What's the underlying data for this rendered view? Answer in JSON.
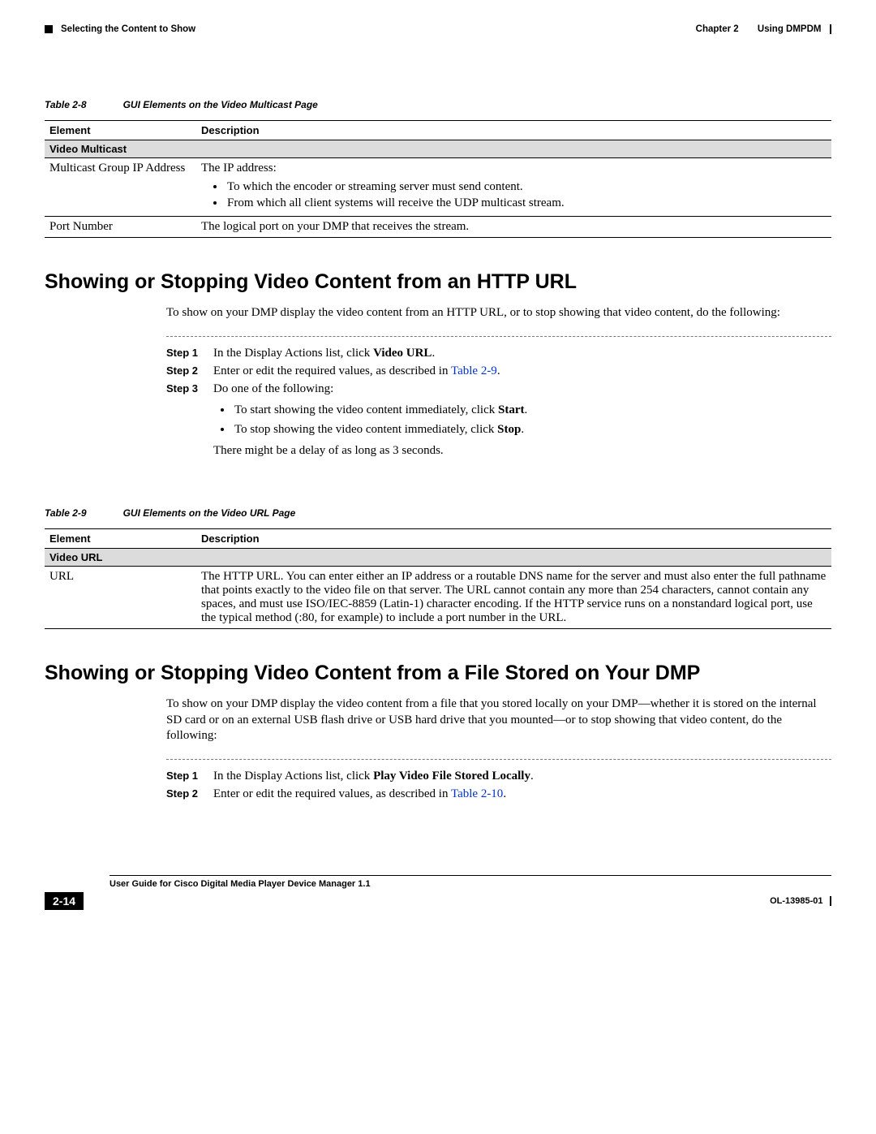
{
  "header": {
    "chapter": "Chapter 2",
    "chapter_title": "Using DMPDM",
    "breadcrumb": "Selecting the Content to Show"
  },
  "table8": {
    "caption_label": "Table 2-8",
    "caption_title": "GUI Elements on the Video Multicast Page",
    "col1": "Element",
    "col2": "Description",
    "section": "Video Multicast",
    "row1_el": "Multicast Group IP Address",
    "row1_desc_intro": "The IP address:",
    "row1_b1": "To which the encoder or streaming server must send content.",
    "row1_b2": "From which all client systems will receive the UDP multicast stream.",
    "row2_el": "Port Number",
    "row2_desc": "The logical port on your DMP that receives the stream."
  },
  "section1": {
    "heading": "Showing or Stopping Video Content from an HTTP URL",
    "intro": "To show on your DMP display the video content from an HTTP URL, or to stop showing that video content, do the following:",
    "step1_label": "Step 1",
    "step1_text_a": "In the Display Actions list, click ",
    "step1_bold": "Video URL",
    "step1_text_b": ".",
    "step2_label": "Step 2",
    "step2_text_a": "Enter or edit the required values, as described in ",
    "step2_link": "Table 2-9",
    "step2_text_b": ".",
    "step3_label": "Step 3",
    "step3_text": "Do one of the following:",
    "step3_b1a": "To start showing the video content immediately, click ",
    "step3_b1b": "Start",
    "step3_b1c": ".",
    "step3_b2a": "To stop showing the video content immediately, click ",
    "step3_b2b": "Stop",
    "step3_b2c": ".",
    "step3_note": "There might be a delay of as long as 3 seconds."
  },
  "table9": {
    "caption_label": "Table 2-9",
    "caption_title": "GUI Elements on the Video URL Page",
    "col1": "Element",
    "col2": "Description",
    "section": "Video URL",
    "row1_el": "URL",
    "row1_desc": "The HTTP URL. You can enter either an IP address or a routable DNS name for the server and must also enter the full pathname that points exactly to the video file on that server. The URL cannot contain any more than 254 characters, cannot contain any spaces, and must use ISO/IEC-8859 (Latin-1) character encoding. If the HTTP service runs on a nonstandard logical port, use the typical method (:80, for example) to include a port number in the URL."
  },
  "section2": {
    "heading": "Showing or Stopping Video Content from a File Stored on Your DMP",
    "intro": "To show on your DMP display the video content from a file that you stored locally on your DMP—whether it is stored on the internal SD card or on an external USB flash drive or USB hard drive that you mounted—or to stop showing that video content, do the following:",
    "step1_label": "Step 1",
    "step1_text_a": "In the Display Actions list, click ",
    "step1_bold": "Play Video File Stored Locally",
    "step1_text_b": ".",
    "step2_label": "Step 2",
    "step2_text_a": "Enter or edit the required values, as described in ",
    "step2_link": "Table 2-10",
    "step2_text_b": "."
  },
  "footer": {
    "guide": "User Guide for Cisco Digital Media Player Device Manager 1.1",
    "page": "2-14",
    "docid": "OL-13985-01"
  }
}
